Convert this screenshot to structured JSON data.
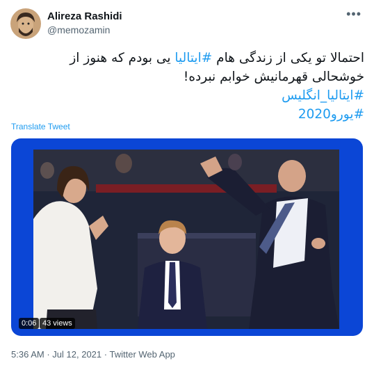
{
  "author": {
    "name": "Alireza Rashidi",
    "handle": "@memozamin"
  },
  "tweet": {
    "line1_pre": "احتمالا تو یکی از زندگی هام ",
    "line1_hashtag": "#ایتالیا",
    "line1_post": " یی بودم که هنوز از",
    "line2": "خوشحالی قهرمانیش خوابم نبرده!",
    "hashtag1": "#ایتالیا_انگلیس",
    "hashtag2": "#یورو2020"
  },
  "translate_label": "Translate Tweet",
  "media": {
    "duration": "0:06",
    "views": "43 views"
  },
  "meta": {
    "time": "5:36 AM",
    "date": "Jul 12, 2021",
    "client": "Twitter Web App",
    "separator": "·"
  },
  "colors": {
    "link": "#1d9bf0",
    "media_frame": "#0b46d6",
    "secondary_text": "#536471"
  }
}
